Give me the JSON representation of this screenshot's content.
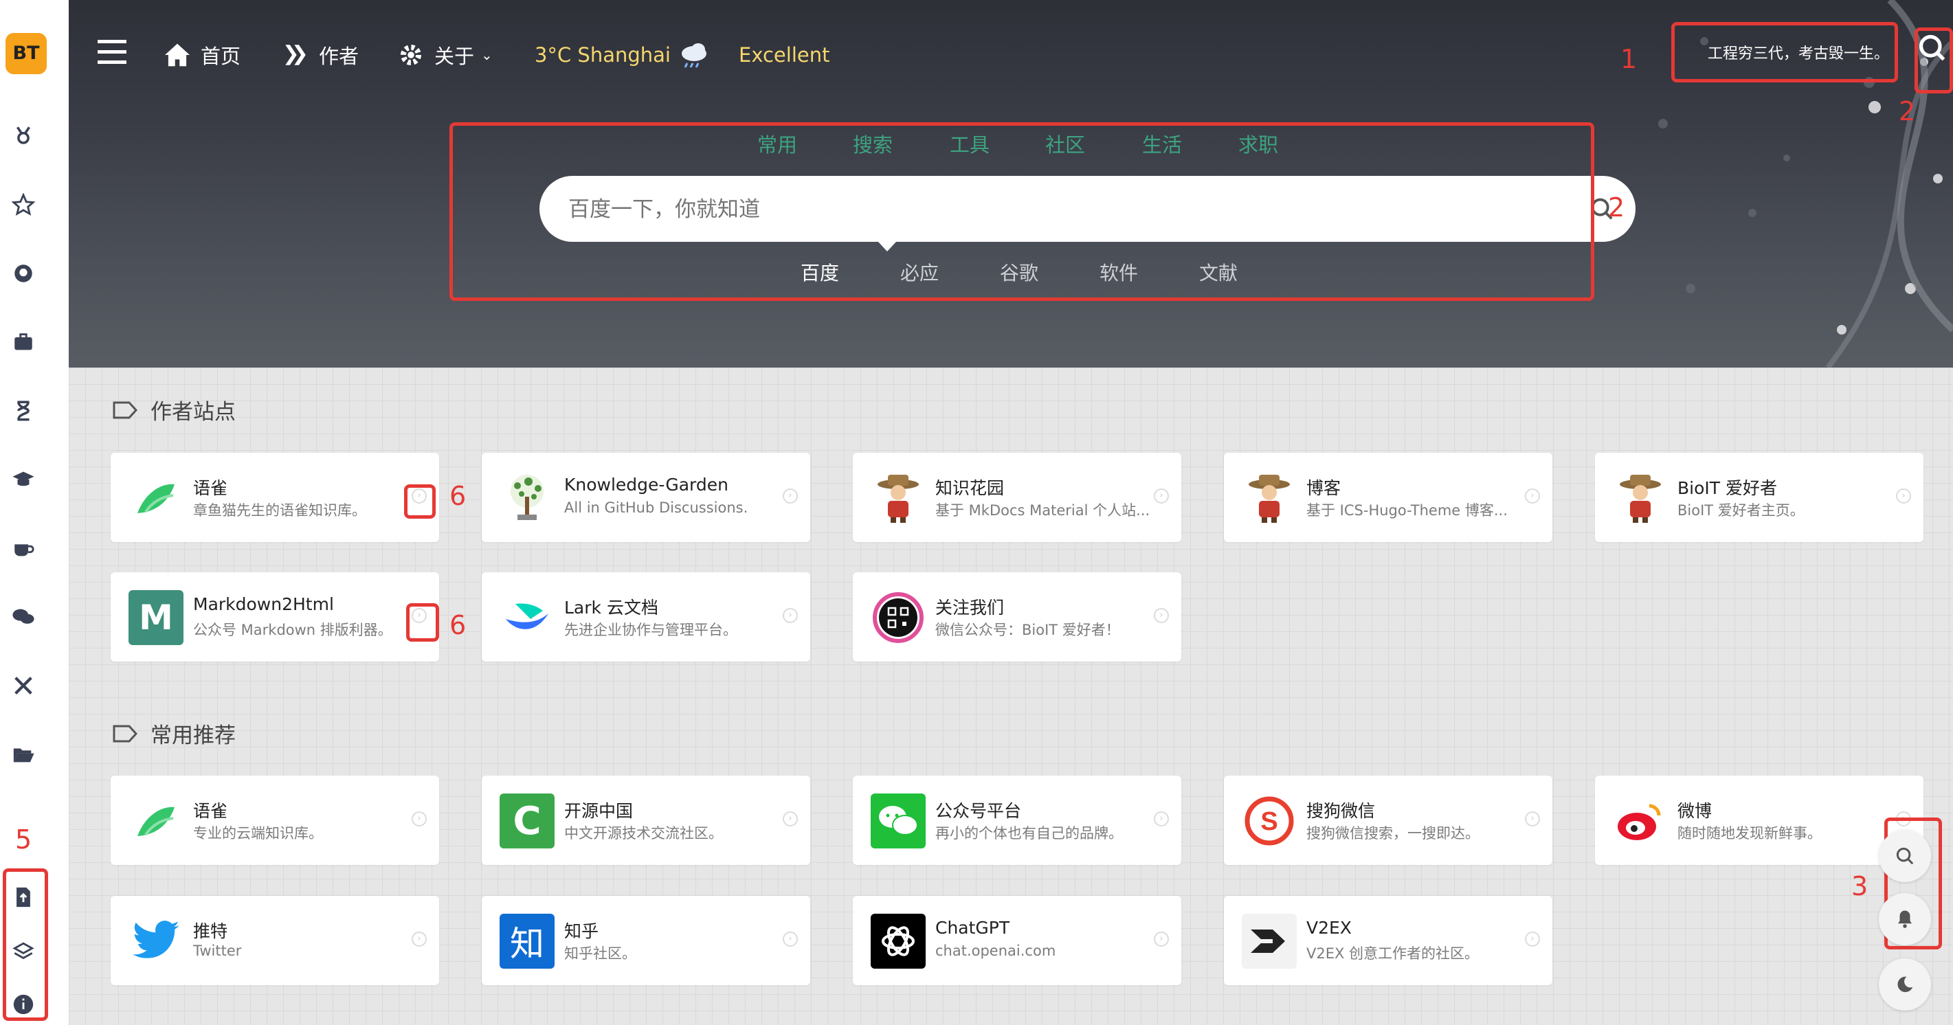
{
  "brand": {
    "logo_text": "BT",
    "logo_color": "#f6a21a"
  },
  "sidebar": {
    "icons": [
      "ribbon-icon",
      "star-icon",
      "github-icon",
      "briefcase-icon",
      "hourglass-icon",
      "graduation-cap-icon",
      "coffee-icon",
      "comments-icon",
      "tools-icon",
      "folder-open-icon",
      "file-upload-icon",
      "layers-icon",
      "info-icon"
    ]
  },
  "nav": {
    "home": "首页",
    "author": "作者",
    "about": "关于",
    "weather_temp": "3°C Shanghai",
    "weather_quality": "Excellent",
    "slogan": "工程穷三代，考古毁一生。"
  },
  "search": {
    "categories": [
      "常用",
      "搜索",
      "工具",
      "社区",
      "生活",
      "求职"
    ],
    "placeholder": "百度一下，你就知道",
    "engines": [
      "百度",
      "必应",
      "谷歌",
      "软件",
      "文献"
    ],
    "active_engine": "百度"
  },
  "annotations": {
    "a1": "1",
    "a2": "2",
    "a2b": "2",
    "a3": "3",
    "a5": "5",
    "a6a": "6",
    "a6b": "6"
  },
  "sections": [
    {
      "title": "作者站点",
      "cards": [
        {
          "title": "语雀",
          "desc": "章鱼猫先生的语雀知识库。"
        },
        {
          "title": "Knowledge-Garden",
          "desc": "All in GitHub Discussions."
        },
        {
          "title": "知识花园",
          "desc": "基于 MkDocs Material 个人站..."
        },
        {
          "title": "博客",
          "desc": "基于 ICS-Hugo-Theme 博客..."
        },
        {
          "title": "BioIT 爱好者",
          "desc": "BioIT 爱好者主页。"
        },
        {
          "title": "Markdown2Html",
          "desc": "公众号 Markdown 排版利器。"
        },
        {
          "title": "Lark 云文档",
          "desc": "先进企业协作与管理平台。"
        },
        {
          "title": "关注我们",
          "desc": "微信公众号：BioIT 爱好者！"
        }
      ]
    },
    {
      "title": "常用推荐",
      "cards": [
        {
          "title": "语雀",
          "desc": "专业的云端知识库。"
        },
        {
          "title": "开源中国",
          "desc": "中文开源技术交流社区。"
        },
        {
          "title": "公众号平台",
          "desc": "再小的个体也有自己的品牌。"
        },
        {
          "title": "搜狗微信",
          "desc": "搜狗微信搜索，一搜即达。"
        },
        {
          "title": "微博",
          "desc": "随时随地发现新鲜事。"
        },
        {
          "title": "推特",
          "desc": "Twitter"
        },
        {
          "title": "知乎",
          "desc": "知乎社区。"
        },
        {
          "title": "ChatGPT",
          "desc": "chat.openai.com"
        },
        {
          "title": "V2EX",
          "desc": "V2EX 创意工作者的社区。"
        }
      ]
    }
  ],
  "colors": {
    "annotation": "#e53935",
    "category": "#3da380",
    "weather": "#f5d76e"
  }
}
